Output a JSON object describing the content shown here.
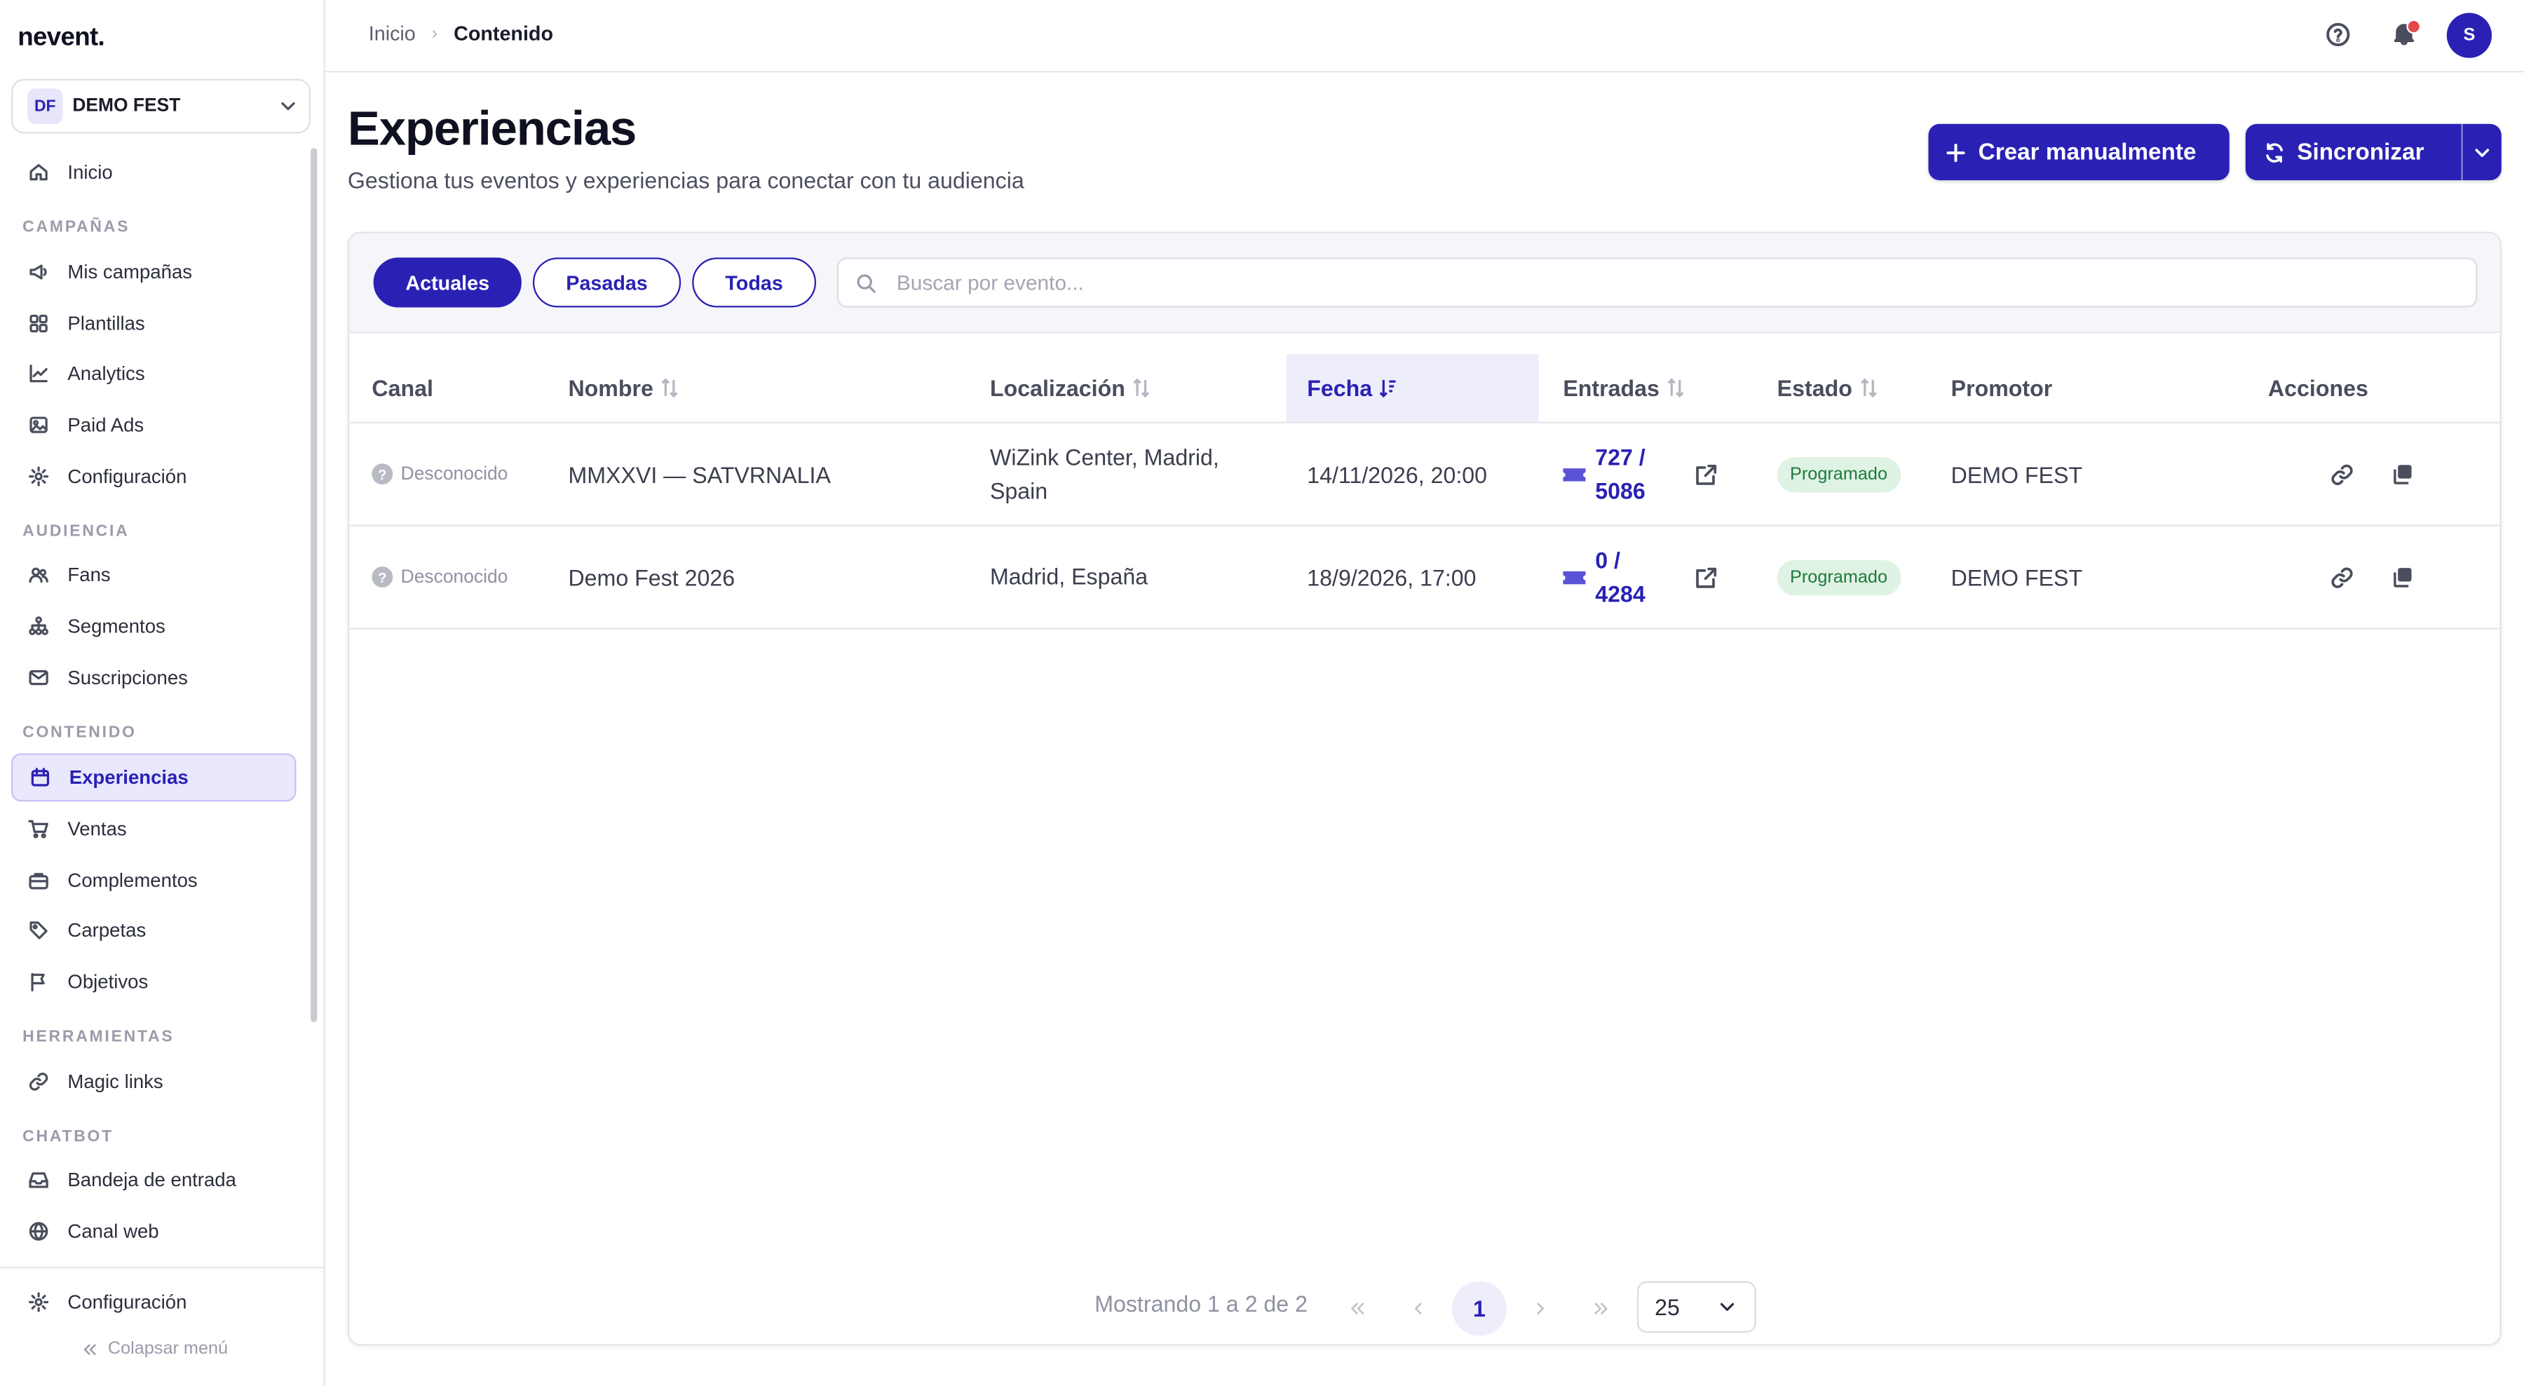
{
  "app": {
    "logo": "nevent."
  },
  "org": {
    "initials": "DF",
    "name": "DEMO FEST"
  },
  "sidebar": {
    "home": "Inicio",
    "sections": {
      "campaigns": "CAMPAÑAS",
      "audience": "AUDIENCIA",
      "content": "CONTENIDO",
      "tools": "HERRAMIENTAS",
      "chatbot": "CHATBOT"
    },
    "campaigns": [
      "Mis campañas",
      "Plantillas",
      "Analytics",
      "Paid Ads",
      "Configuración"
    ],
    "audience": [
      "Fans",
      "Segmentos",
      "Suscripciones"
    ],
    "content": [
      "Experiencias",
      "Ventas",
      "Complementos",
      "Carpetas",
      "Objetivos"
    ],
    "tools": [
      "Magic links"
    ],
    "chatbot": [
      "Bandeja de entrada",
      "Canal web"
    ],
    "settings": "Configuración",
    "collapse": "Colapsar menú"
  },
  "header": {
    "breadcrumb": [
      "Inicio",
      "Contenido"
    ],
    "avatar_initial": "S"
  },
  "page": {
    "title": "Experiencias",
    "subtitle": "Gestiona tus eventos y experiencias para conectar con tu audiencia",
    "create_button": "Crear manualmente",
    "sync_button": "Sincronizar"
  },
  "filters": {
    "tabs": [
      "Actuales",
      "Pasadas",
      "Todas"
    ],
    "active_tab": "Actuales",
    "search_placeholder": "Buscar por evento..."
  },
  "table": {
    "columns": [
      "Canal",
      "Nombre",
      "Localización",
      "Fecha",
      "Entradas",
      "Estado",
      "Promotor",
      "Acciones"
    ],
    "sorted_column": "Fecha",
    "rows": [
      {
        "canal": "Desconocido",
        "nombre": "MMXXVI — SATVRNALIA",
        "localizacion": "WiZink Center, Madrid, Spain",
        "fecha": "14/11/2026, 20:00",
        "entradas": "727 / 5086",
        "estado": "Programado",
        "promotor": "DEMO FEST"
      },
      {
        "canal": "Desconocido",
        "nombre": "Demo Fest 2026",
        "localizacion": "Madrid, España",
        "fecha": "18/9/2026, 17:00",
        "entradas": "0 / 4284",
        "estado": "Programado",
        "promotor": "DEMO FEST"
      }
    ]
  },
  "pagination": {
    "summary": "Mostrando 1 a 2 de 2",
    "current_page": "1",
    "per_page": "25"
  },
  "colors": {
    "primary": "#2a21b4",
    "active_bg": "#e9e8fc",
    "status_bg": "#dff3e4",
    "status_text": "#1e7a3c",
    "notification": "#e5484d"
  }
}
